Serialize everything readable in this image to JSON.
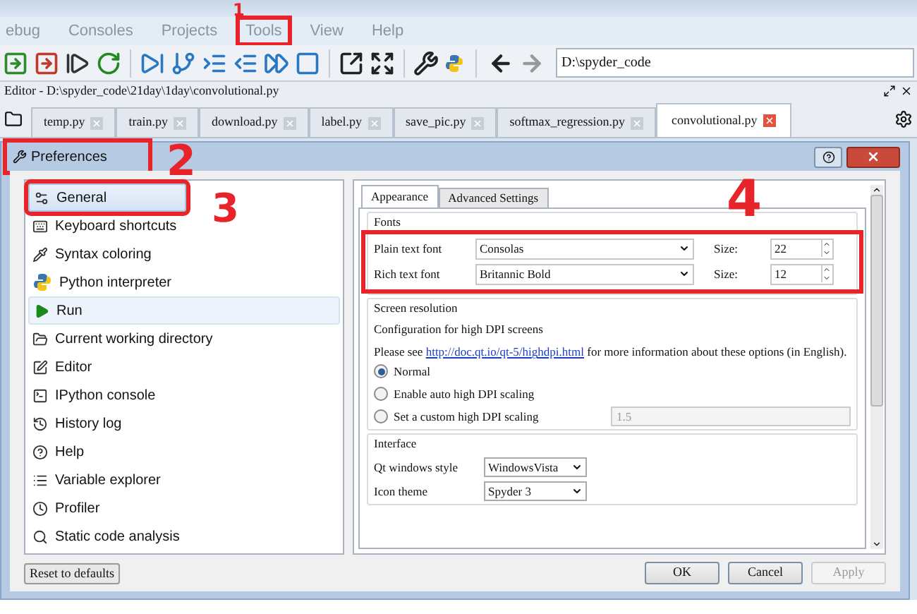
{
  "menu": [
    {
      "label": "ebug",
      "annotated": false
    },
    {
      "label": "Consoles",
      "annotated": false
    },
    {
      "label": "Projects",
      "annotated": false
    },
    {
      "label": "Tools",
      "annotated": true
    },
    {
      "label": "View",
      "annotated": false
    },
    {
      "label": "Help",
      "annotated": false
    }
  ],
  "path_field": {
    "value": "D:\\spyder_code"
  },
  "editor": {
    "title": "Editor - D:\\spyder_code\\21day\\1day\\convolutional.py",
    "tabs": [
      {
        "label": "temp.py",
        "selected": false
      },
      {
        "label": "train.py",
        "selected": false
      },
      {
        "label": "download.py",
        "selected": false
      },
      {
        "label": "label.py",
        "selected": false
      },
      {
        "label": "save_pic.py",
        "selected": false
      },
      {
        "label": "softmax_regression.py",
        "selected": false
      },
      {
        "label": "convolutional.py",
        "selected": true
      }
    ]
  },
  "dialog": {
    "title": "Preferences",
    "title_annotated": true,
    "pages": [
      {
        "label": "General",
        "selected": true,
        "highlighted": false,
        "annotated": true
      },
      {
        "label": "Keyboard shortcuts",
        "selected": false,
        "highlighted": false,
        "annotated": false
      },
      {
        "label": "Syntax coloring",
        "selected": false,
        "highlighted": false,
        "annotated": false
      },
      {
        "label": "Python interpreter",
        "selected": false,
        "highlighted": false,
        "annotated": false
      },
      {
        "label": "Run",
        "selected": false,
        "highlighted": true,
        "annotated": false
      },
      {
        "label": "Current working directory",
        "selected": false,
        "highlighted": false,
        "annotated": false
      },
      {
        "label": "Editor",
        "selected": false,
        "highlighted": false,
        "annotated": false
      },
      {
        "label": "IPython console",
        "selected": false,
        "highlighted": false,
        "annotated": false
      },
      {
        "label": "History log",
        "selected": false,
        "highlighted": false,
        "annotated": false
      },
      {
        "label": "Help",
        "selected": false,
        "highlighted": false,
        "annotated": false
      },
      {
        "label": "Variable explorer",
        "selected": false,
        "highlighted": false,
        "annotated": false
      },
      {
        "label": "Profiler",
        "selected": false,
        "highlighted": false,
        "annotated": false
      },
      {
        "label": "Static code analysis",
        "selected": false,
        "highlighted": false,
        "annotated": false
      }
    ],
    "tabs": [
      {
        "label": "Appearance",
        "selected": true
      },
      {
        "label": "Advanced Settings",
        "selected": false
      }
    ],
    "fonts": {
      "title": "Fonts",
      "annotated": true,
      "rows": [
        {
          "label": "Plain text font",
          "font": "Consolas",
          "size_label": "Size:",
          "size": "22"
        },
        {
          "label": "Rich text font",
          "font": "Britannic Bold",
          "size_label": "Size:",
          "size": "12"
        }
      ]
    },
    "screen_resolution": {
      "title": "Screen resolution",
      "description": "Configuration for high DPI screens",
      "note_before": "Please see ",
      "link": "http://doc.qt.io/qt-5/highdpi.html",
      "note_after": " for more information about these options (in English).",
      "options": [
        {
          "label": "Normal",
          "selected": true
        },
        {
          "label": "Enable auto high DPI scaling",
          "selected": false
        },
        {
          "label": "Set a custom high DPI scaling",
          "selected": false
        }
      ],
      "custom_value": "1.5"
    },
    "interface": {
      "title": "Interface",
      "rows": [
        {
          "label": "Qt windows style",
          "value": "WindowsVista"
        },
        {
          "label": "Icon theme",
          "value": "Spyder 3"
        }
      ]
    },
    "reset": "Reset to defaults",
    "buttons": [
      {
        "label": "OK",
        "disabled": false
      },
      {
        "label": "Cancel",
        "disabled": false
      },
      {
        "label": "Apply",
        "disabled": true
      }
    ]
  },
  "annotations": [
    {
      "label": "1"
    },
    {
      "label": "2"
    },
    {
      "label": "3"
    },
    {
      "label": "4"
    }
  ]
}
